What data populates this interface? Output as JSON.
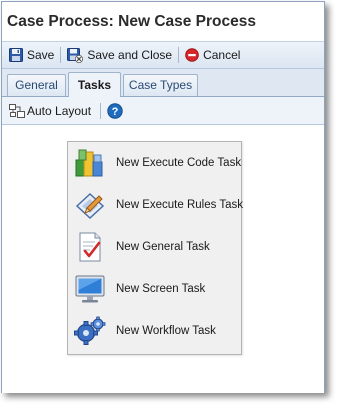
{
  "window": {
    "title": "Case Process: New Case Process"
  },
  "toolbar": {
    "save": {
      "label": "Save",
      "icon": "save-icon"
    },
    "save_close": {
      "label": "Save and Close",
      "icon": "save-close-icon"
    },
    "cancel": {
      "label": "Cancel",
      "icon": "cancel-icon"
    }
  },
  "tabs": [
    {
      "label": "General",
      "active": false
    },
    {
      "label": "Tasks",
      "active": true
    },
    {
      "label": "Case Types",
      "active": false
    }
  ],
  "subtoolbar": {
    "auto_layout": {
      "label": "Auto Layout",
      "icon": "auto-layout-icon"
    },
    "help": {
      "icon": "help-icon"
    }
  },
  "menu": {
    "items": [
      {
        "label": "New Execute Code Task",
        "icon": "execute-code-icon"
      },
      {
        "label": "New Execute Rules Task",
        "icon": "execute-rules-icon"
      },
      {
        "label": "New General Task",
        "icon": "general-task-icon"
      },
      {
        "label": "New Screen Task",
        "icon": "screen-task-icon"
      },
      {
        "label": "New Workflow Task",
        "icon": "workflow-task-icon"
      }
    ]
  },
  "colors": {
    "toolbar_bg": "#dbe6f2",
    "window_border": "#8da3bd",
    "menu_bg": "#f0f0f0",
    "help_blue": "#1e6bbf",
    "cancel_red": "#d8272b"
  }
}
